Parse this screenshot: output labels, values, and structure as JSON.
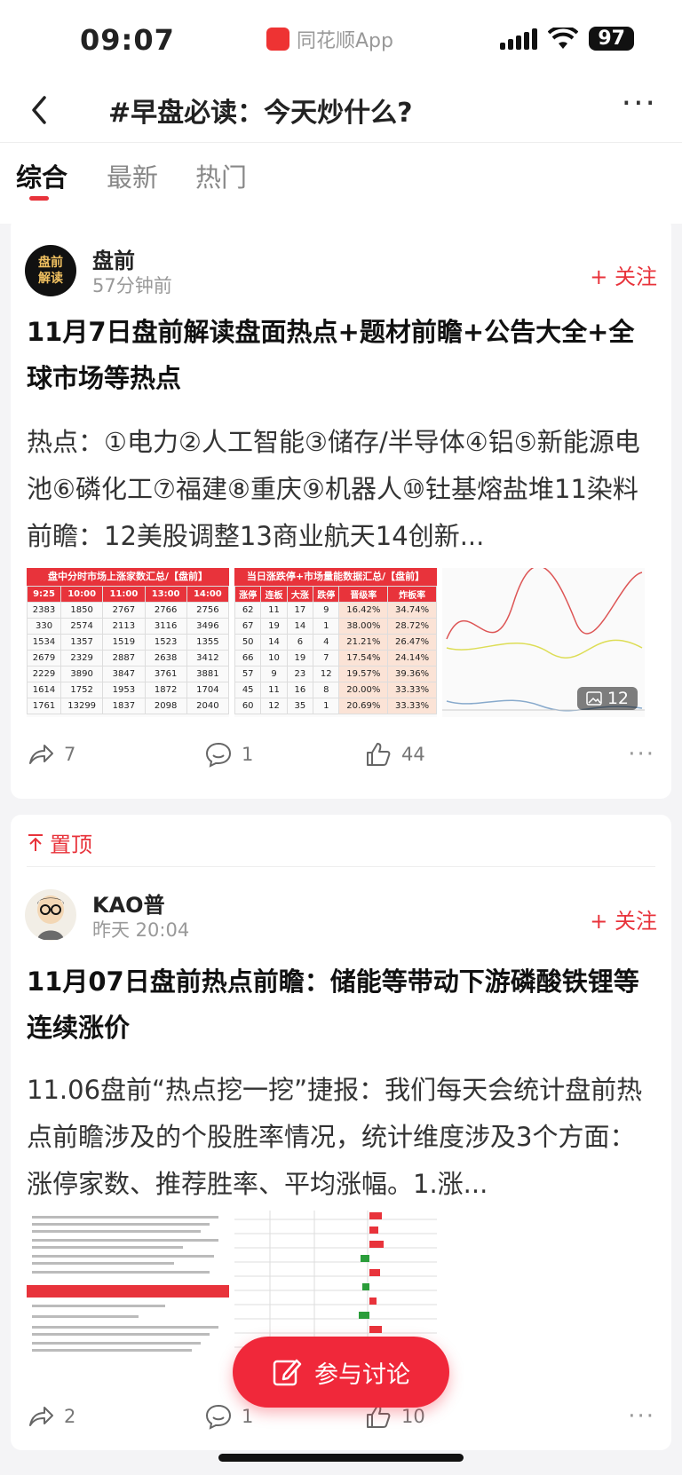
{
  "status_bar": {
    "time": "09:07",
    "app_name": "同花顺App",
    "battery": "97"
  },
  "nav": {
    "title": "#早盘必读：今天炒什么?"
  },
  "tabs": [
    {
      "label": "综合"
    },
    {
      "label": "最新"
    },
    {
      "label": "热门"
    }
  ],
  "posts": [
    {
      "author": "盘前",
      "avatar_text": "盘前解读",
      "time": "57分钟前",
      "follow_label": "+ 关注",
      "title": "11月7日盘前解读盘面热点+题材前瞻+公告大全+全球市场等热点",
      "body": "热点：①电力②人工智能③储存/半导体④铝⑤新能源电池⑥磷化工⑦福建⑧重庆⑨机器人⑩钍基熔盐堆11染料前瞻：12美股调整13商业航天14创新...",
      "image_count": "12",
      "table1": {
        "title": "盘中分时市场上涨家数汇总/【盘前】",
        "headers": [
          "9:25",
          "10:00",
          "11:00",
          "13:00",
          "14:00"
        ],
        "rows": [
          [
            "2383",
            "1850",
            "2767",
            "2766",
            "2756"
          ],
          [
            "330",
            "2574",
            "2113",
            "3116",
            "3496"
          ],
          [
            "1534",
            "1357",
            "1519",
            "1523",
            "1355"
          ],
          [
            "2679",
            "2329",
            "2887",
            "2638",
            "3412"
          ],
          [
            "2229",
            "3890",
            "3847",
            "3761",
            "3881"
          ],
          [
            "1614",
            "1752",
            "1953",
            "1872",
            "1704"
          ],
          [
            "1761",
            "13299",
            "1837",
            "2098",
            "2040"
          ]
        ]
      },
      "table2": {
        "title": "当日涨跌停+市场量能数据汇总/【盘前】",
        "headers": [
          "涨停",
          "连板",
          "大涨",
          "跌停",
          "晋级率",
          "炸板率"
        ],
        "rows": [
          [
            "62",
            "11",
            "17",
            "9",
            "16.42%",
            "34.74%"
          ],
          [
            "67",
            "19",
            "14",
            "1",
            "38.00%",
            "28.72%"
          ],
          [
            "50",
            "14",
            "6",
            "4",
            "21.21%",
            "26.47%"
          ],
          [
            "66",
            "10",
            "19",
            "7",
            "17.54%",
            "24.14%"
          ],
          [
            "57",
            "9",
            "23",
            "12",
            "19.57%",
            "39.36%"
          ],
          [
            "45",
            "11",
            "16",
            "8",
            "20.00%",
            "33.33%"
          ],
          [
            "60",
            "12",
            "35",
            "1",
            "20.69%",
            "33.33%"
          ]
        ]
      },
      "stats": {
        "share": "7",
        "comment": "1",
        "like": "44"
      }
    },
    {
      "pinned_label": "置顶",
      "author": "KAO普",
      "time": "昨天 20:04",
      "follow_label": "+ 关注",
      "title": "11月07日盘前热点前瞻：储能等带动下游磷酸铁锂等连续涨价",
      "body": "11.06盘前“热点挖一挖”捷报：我们每天会统计盘前热点前瞻涉及的个股胜率情况，统计维度涉及3个方面：涨停家数、推荐胜率、平均涨幅。1.涨...",
      "stats": {
        "share": "2",
        "comment": "1",
        "like": "10"
      }
    }
  ],
  "fab_label": "参与讨论",
  "colors": {
    "accent": "#e8333b",
    "background": "#f4f4f6"
  }
}
